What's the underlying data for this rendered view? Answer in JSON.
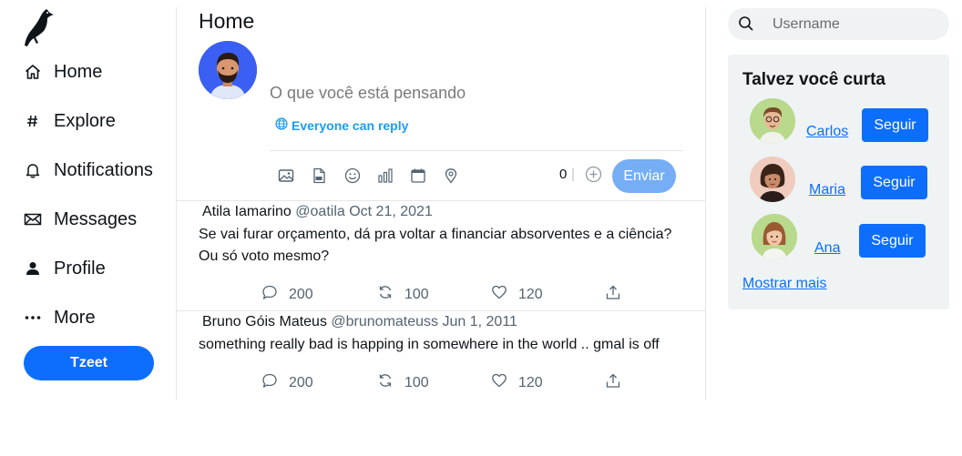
{
  "sidebar": {
    "items": [
      {
        "label": "Home",
        "icon": "home-icon"
      },
      {
        "label": "Explore",
        "icon": "hash-icon"
      },
      {
        "label": "Notifications",
        "icon": "bell-icon"
      },
      {
        "label": "Messages",
        "icon": "envelope-icon"
      },
      {
        "label": "Profile",
        "icon": "person-icon"
      },
      {
        "label": "More",
        "icon": "more-icon"
      }
    ],
    "cta_label": "Tzeet"
  },
  "main": {
    "title": "Home",
    "compose": {
      "placeholder": "O que você está pensando",
      "reply_setting": "Everyone can reply",
      "char_count": "0",
      "separator": "|",
      "send_label": "Enviar",
      "tools": [
        "image-icon",
        "gif-icon",
        "emoji-icon",
        "poll-icon",
        "schedule-icon",
        "location-icon"
      ]
    },
    "posts": [
      {
        "name": "Atila Iamarino",
        "meta": "@oatila Oct 21, 2021",
        "text": "Se vai furar orçamento, dá pra voltar a financiar absorventes e a ciência? Ou só voto mesmo?",
        "replies": "200",
        "retweets": "100",
        "likes": "120"
      },
      {
        "name": "Bruno Góis Mateus",
        "meta": "@brunomateuss Jun 1, 2011",
        "text": "something really bad is happing in somewhere in the world .. gmal is off",
        "replies": "200",
        "retweets": "100",
        "likes": "120"
      }
    ]
  },
  "right": {
    "search_placeholder": "Username",
    "suggest_title": "Talvez você curta",
    "suggestions": [
      {
        "name": "Carlos",
        "button": "Seguir"
      },
      {
        "name": "Maria",
        "button": "Seguir"
      },
      {
        "name": "Ana",
        "button": "Seguir"
      }
    ],
    "show_more": "Mostrar mais"
  },
  "colors": {
    "accent": "#0d6efd",
    "send_disabled": "#75aef5",
    "link_blue": "#1d9bf0",
    "panel_bg": "#eff3f4"
  }
}
